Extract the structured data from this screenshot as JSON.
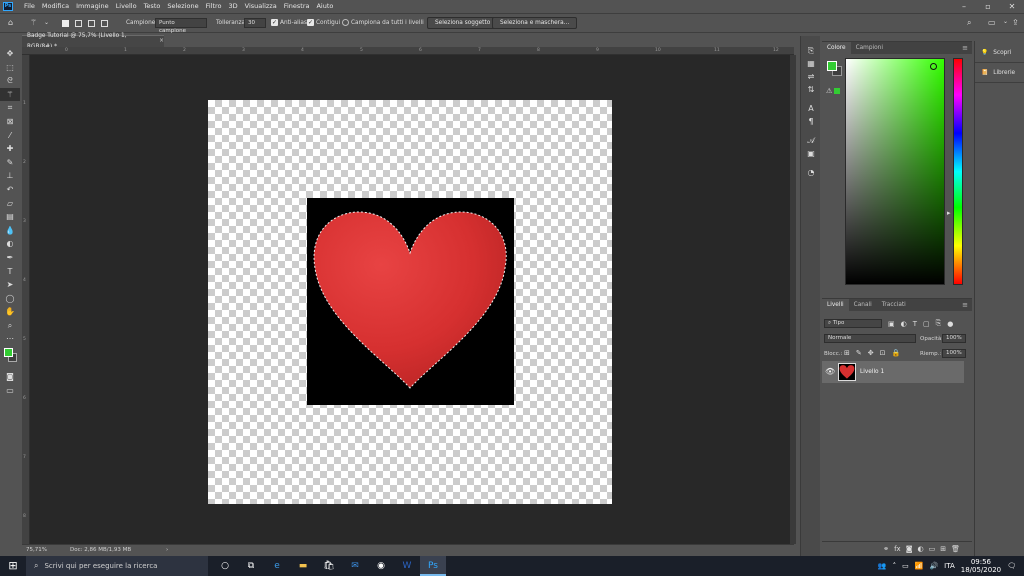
{
  "app": {
    "logo_text": "Ps"
  },
  "menu": [
    "File",
    "Modifica",
    "Immagine",
    "Livello",
    "Testo",
    "Selezione",
    "Filtro",
    "3D",
    "Visualizza",
    "Finestra",
    "Aiuto"
  ],
  "options_bar": {
    "sample_label": "Campione:",
    "sample_value": "Punto campione",
    "tolerance_label": "Tolleranza:",
    "tolerance_value": "30",
    "antialias_label": "Anti-alias",
    "contiguous_label": "Contigui",
    "sample_all_label": "Campiona da tutti i livelli",
    "select_subject_label": "Seleziona soggetto",
    "select_mask_label": "Seleziona e maschera..."
  },
  "document": {
    "tab_title": "Badge Tutorial @ 75,7% (Livello 1, RGB/8#) *",
    "tab_close": "×"
  },
  "ruler_ticks": [
    "0",
    "1",
    "2",
    "3",
    "4",
    "5",
    "6",
    "7",
    "8",
    "9",
    "10",
    "11",
    "12"
  ],
  "status": {
    "zoom": "75,71%",
    "doc_info": "Doc: 2,86 MB/1,93 MB",
    "arrow": "›"
  },
  "color_panel": {
    "tabs": [
      "Colore",
      "Campioni"
    ],
    "fg_color": "#33cc33",
    "bg_color": "#3f3f3f"
  },
  "layers_panel": {
    "tabs": [
      "Livelli",
      "Canali",
      "Tracciati"
    ],
    "filter_value": "Tipo",
    "blend_mode": "Normale",
    "opacity_label": "Opacità:",
    "opacity_value": "100%",
    "lock_label": "Blocc.:",
    "fill_label": "Riemp.:",
    "fill_value": "100%",
    "layer_name": "Livello 1"
  },
  "learn_panel": {
    "discover_label": "Scopri",
    "libraries_label": "Librerie"
  },
  "taskbar": {
    "search_placeholder": "Scrivi qui per eseguire la ricerca",
    "language": "ITA",
    "time": "09:56",
    "date": "18/05/2020"
  }
}
